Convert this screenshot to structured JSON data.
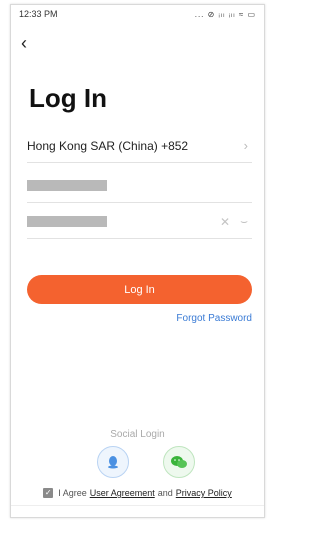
{
  "status_bar": {
    "time": "12:33 PM",
    "icons": "... ⊘ ᵢₗₗ ᵢₗₗ ≈ ▭"
  },
  "header": {
    "back_icon": "back-arrow-icon"
  },
  "page": {
    "title": "Log In"
  },
  "form": {
    "region": "Hong Kong SAR (China) +852",
    "phone_value_masked": true,
    "password_value_masked": true
  },
  "actions": {
    "login_label": "Log In",
    "forgot_label": "Forgot Password"
  },
  "social": {
    "label": "Social Login",
    "providers": [
      "qq-icon",
      "wechat-icon"
    ]
  },
  "agreement": {
    "checked": true,
    "prefix": "I Agree",
    "user_agreement": "User Agreement",
    "and": "and",
    "privacy_policy": "Privacy Policy"
  },
  "colors": {
    "accent": "#f4622f",
    "link": "#3a7bd5"
  }
}
